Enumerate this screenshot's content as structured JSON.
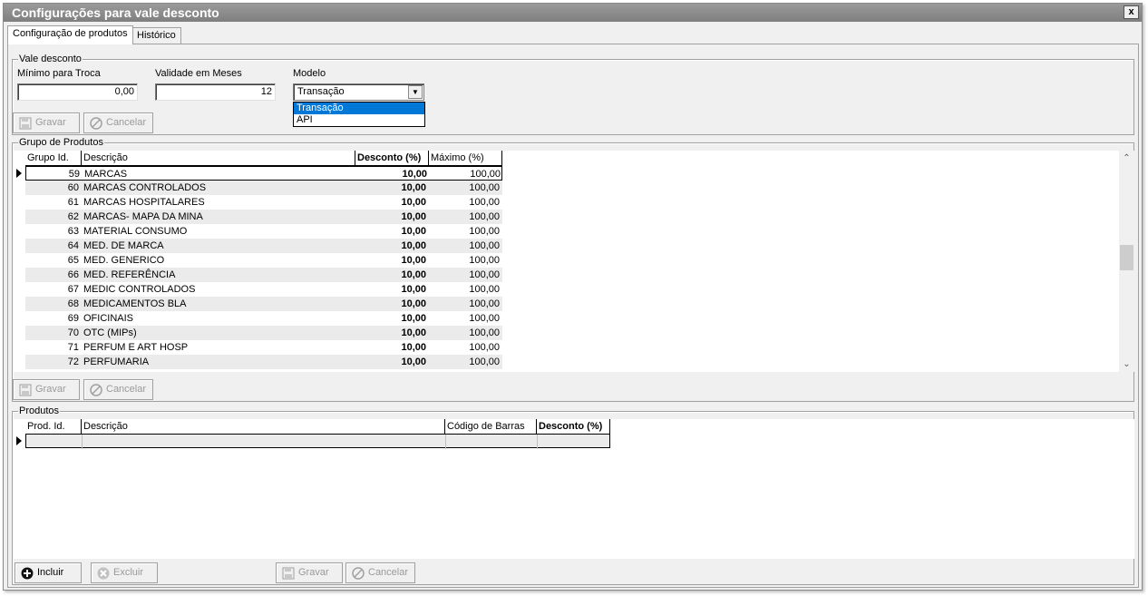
{
  "window": {
    "title": "Configurações para vale desconto",
    "close_label": "x"
  },
  "tabs": [
    "Configuração de produtos",
    "Histórico"
  ],
  "vale": {
    "legend": "Vale desconto",
    "min_label": "Mínimo para Troca",
    "min_value": "0,00",
    "validade_label": "Validade em Meses",
    "validade_value": "12",
    "modelo_label": "Modelo",
    "modelo_value": "Transação",
    "modelo_options": [
      "Transação",
      "API"
    ],
    "gravar": "Gravar",
    "cancelar": "Cancelar"
  },
  "grupo": {
    "legend": "Grupo de Produtos",
    "columns": [
      "Grupo Id.",
      "Descrição",
      "Desconto (%)",
      "Máximo (%)"
    ],
    "rows": [
      {
        "id": "59",
        "desc": "MARCAS",
        "desconto": "10,00",
        "maximo": "100,00"
      },
      {
        "id": "60",
        "desc": "MARCAS CONTROLADOS",
        "desconto": "10,00",
        "maximo": "100,00"
      },
      {
        "id": "61",
        "desc": "MARCAS HOSPITALARES",
        "desconto": "10,00",
        "maximo": "100,00"
      },
      {
        "id": "62",
        "desc": "MARCAS- MAPA DA MINA",
        "desconto": "10,00",
        "maximo": "100,00"
      },
      {
        "id": "63",
        "desc": "MATERIAL CONSUMO",
        "desconto": "10,00",
        "maximo": "100,00"
      },
      {
        "id": "64",
        "desc": "MED. DE MARCA",
        "desconto": "10,00",
        "maximo": "100,00"
      },
      {
        "id": "65",
        "desc": "MED. GENERICO",
        "desconto": "10,00",
        "maximo": "100,00"
      },
      {
        "id": "66",
        "desc": "MED. REFERÊNCIA",
        "desconto": "10,00",
        "maximo": "100,00"
      },
      {
        "id": "67",
        "desc": "MEDIC CONTROLADOS",
        "desconto": "10,00",
        "maximo": "100,00"
      },
      {
        "id": "68",
        "desc": "MEDICAMENTOS BLA",
        "desconto": "10,00",
        "maximo": "100,00"
      },
      {
        "id": "69",
        "desc": "OFICINAIS",
        "desconto": "10,00",
        "maximo": "100,00"
      },
      {
        "id": "70",
        "desc": "OTC (MIPs)",
        "desconto": "10,00",
        "maximo": "100,00"
      },
      {
        "id": "71",
        "desc": "PERFUM E ART HOSP",
        "desconto": "10,00",
        "maximo": "100,00"
      },
      {
        "id": "72",
        "desc": "PERFUMARIA",
        "desconto": "10,00",
        "maximo": "100,00"
      }
    ],
    "gravar": "Gravar",
    "cancelar": "Cancelar"
  },
  "produtos": {
    "legend": "Produtos",
    "columns": [
      "Prod. Id.",
      "Descrição",
      "Código de Barras",
      "Desconto (%)"
    ],
    "incluir": "Incluir",
    "excluir": "Excluir",
    "gravar": "Gravar",
    "cancelar": "Cancelar"
  },
  "icons": {
    "close": "close-icon",
    "save": "floppy-disk-icon",
    "cancel": "cancel-icon",
    "add": "plus-circle-icon",
    "delete": "x-circle-icon",
    "row_indicator": "row-indicator-icon",
    "dropdown": "chevron-down-icon"
  }
}
